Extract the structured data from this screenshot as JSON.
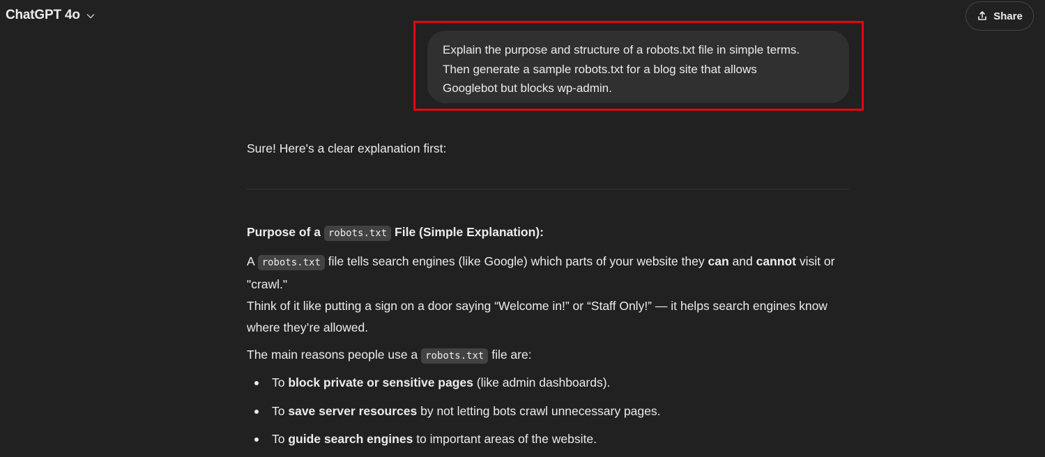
{
  "header": {
    "model_name": "ChatGPT 4o",
    "share_label": "Share"
  },
  "user_message": {
    "lines": [
      "Explain the purpose and structure of a robots.txt file in simple terms.",
      "Then generate a sample robots.txt for a blog site that allows",
      "Googlebot but blocks wp-admin."
    ]
  },
  "assistant": {
    "intro": "Sure! Here's a clear explanation first:",
    "heading": {
      "before": "Purpose of a",
      "code": "robots.txt",
      "after": "File (Simple Explanation):"
    },
    "para1": {
      "a": "A",
      "code": "robots.txt",
      "t1": "file tells search engines (like Google) which parts of your website they",
      "b1": "can",
      "t2": "and",
      "b2": "cannot",
      "t3": "visit or \"crawl.\"",
      "line2": "Think of it like putting a sign on a door saying “Welcome in!” or “Staff Only!” — it helps search engines know where they’re allowed."
    },
    "para2": {
      "before": "The main reasons people use a",
      "code": "robots.txt",
      "after": "file are:"
    },
    "bullets": [
      {
        "pre": "To",
        "bold": "block private or sensitive pages",
        "post": "(like admin dashboards)."
      },
      {
        "pre": "To",
        "bold": "save server resources",
        "post": "by not letting bots crawl unnecessary pages."
      },
      {
        "pre": "To",
        "bold": "guide search engines",
        "post": "to important areas of the website."
      }
    ]
  },
  "colors": {
    "background": "#212121",
    "bubble": "#303030",
    "highlight": "#e30613",
    "code_bg": "#424242"
  },
  "icons": [
    "chevron-down-icon",
    "share-icon"
  ]
}
